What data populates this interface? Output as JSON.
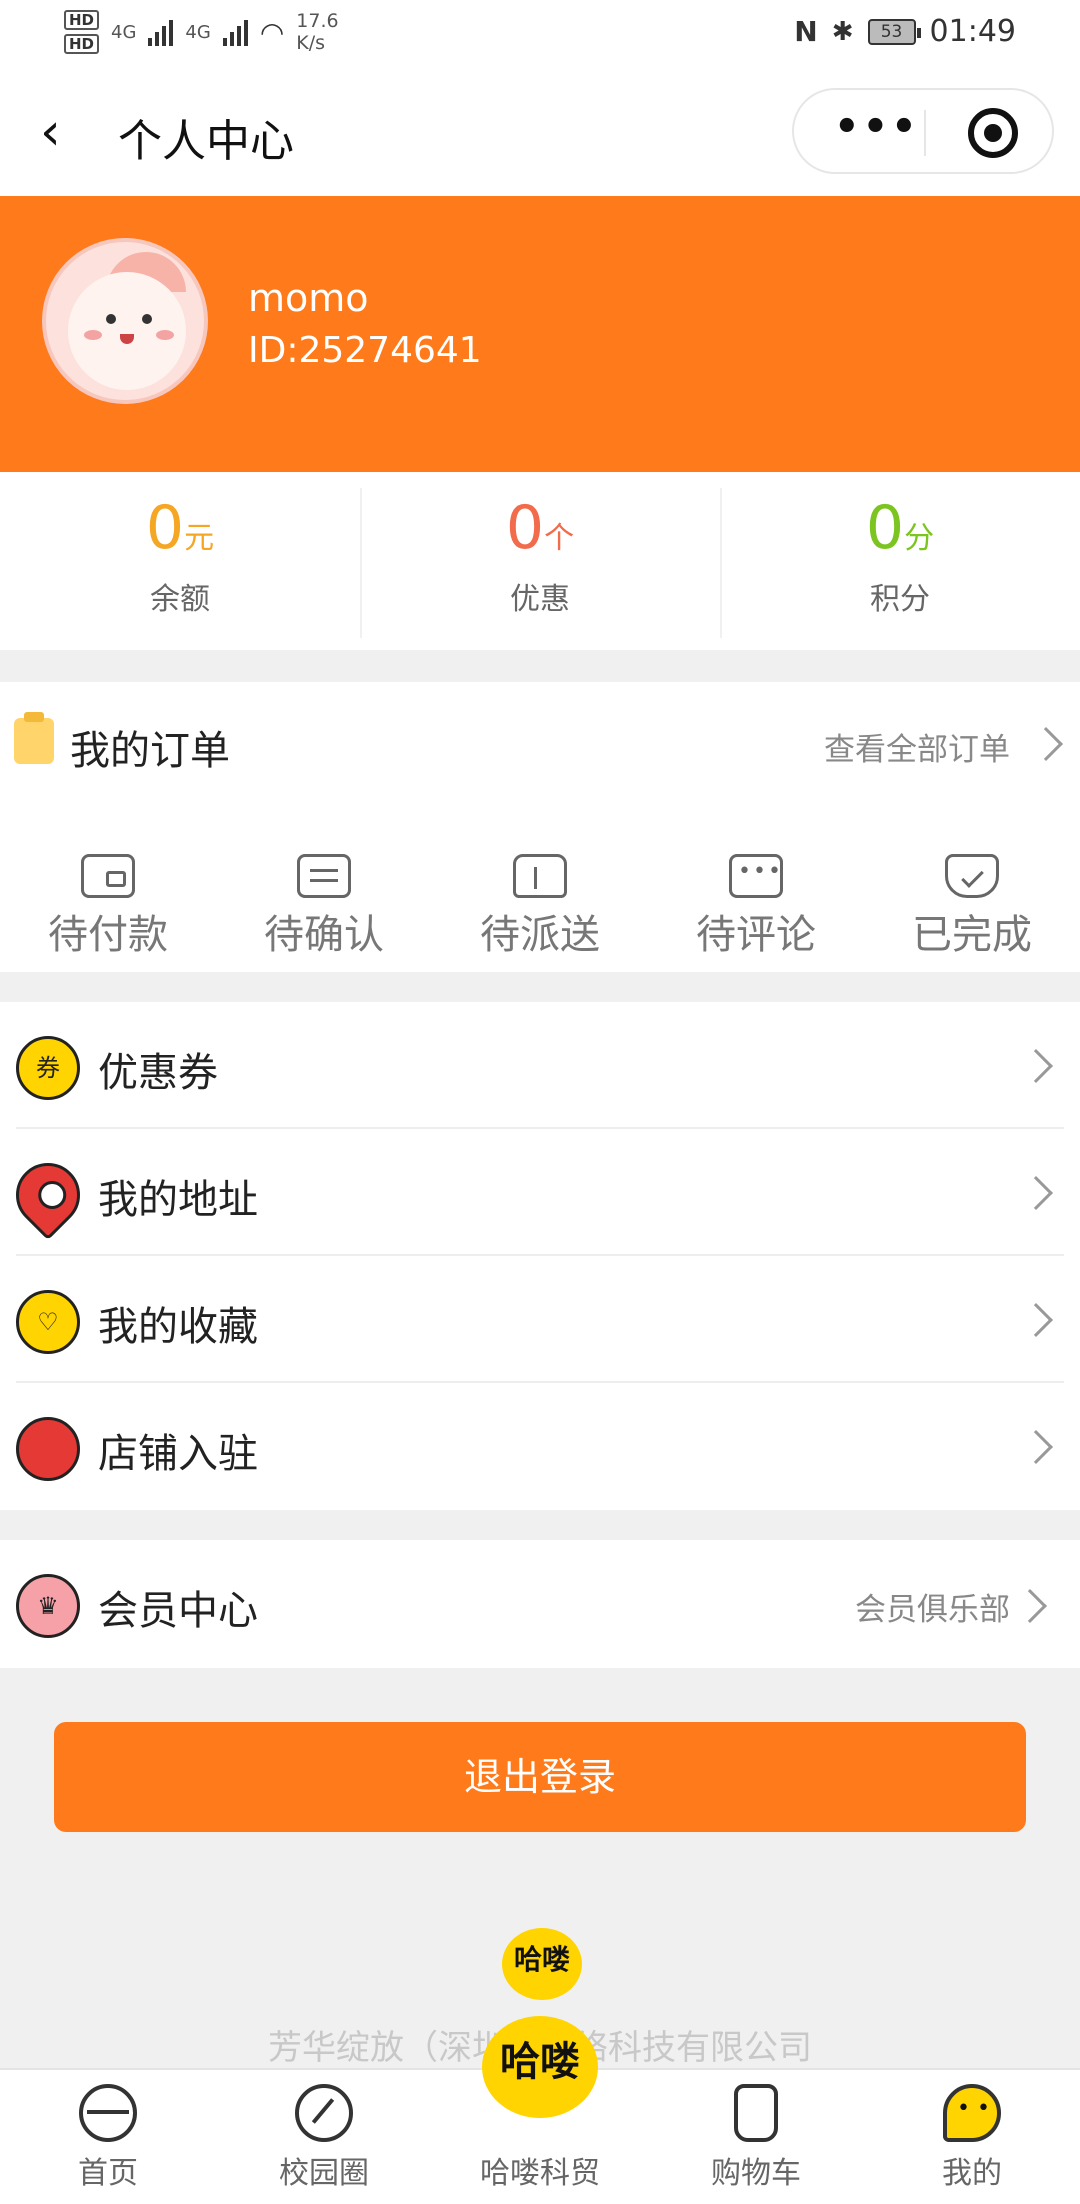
{
  "status_bar": {
    "hd1": "HD",
    "hd2": "HD",
    "net1": "4G",
    "net2": "4G",
    "speed": "17.6",
    "speed_unit": "K/s",
    "nfc": "N",
    "bluetooth": "✱",
    "battery": "53",
    "time": "01:49"
  },
  "nav": {
    "back": "‹",
    "title": "个人中心",
    "more": "•••"
  },
  "profile": {
    "username": "momo",
    "user_id": "ID:25274641"
  },
  "stats": [
    {
      "value": "0",
      "unit": "元",
      "label": "余额",
      "color": "#f5a623"
    },
    {
      "value": "0",
      "unit": "个",
      "label": "优惠",
      "color": "#f26b4a"
    },
    {
      "value": "0",
      "unit": "分",
      "label": "积分",
      "color": "#7cc520"
    }
  ],
  "orders": {
    "title": "我的订单",
    "view_all": "查看全部订单",
    "items": [
      {
        "label": "待付款",
        "icon": "wallet-icon"
      },
      {
        "label": "待确认",
        "icon": "confirm-icon"
      },
      {
        "label": "待派送",
        "icon": "delivery-icon"
      },
      {
        "label": "待评论",
        "icon": "comment-icon"
      },
      {
        "label": "已完成",
        "icon": "done-icon"
      }
    ]
  },
  "menu": [
    {
      "label": "优惠券",
      "icon": "coupon-icon",
      "icon_text": "券"
    },
    {
      "label": "我的地址",
      "icon": "location-icon",
      "icon_text": ""
    },
    {
      "label": "我的收藏",
      "icon": "heart-icon",
      "icon_text": "♡"
    },
    {
      "label": "店铺入驻",
      "icon": "shop-icon",
      "icon_text": ""
    }
  ],
  "vip": {
    "label": "会员中心",
    "right": "会员俱乐部",
    "icon": "crown-icon",
    "icon_text": "♛"
  },
  "logout_label": "退出登录",
  "brand": {
    "logo_text": "哈喽",
    "company": "芳华绽放（深圳）网络科技有限公司"
  },
  "tabbar": [
    {
      "label": "首页",
      "icon": "home-icon"
    },
    {
      "label": "校园圈",
      "icon": "campus-icon"
    },
    {
      "label": "哈喽科贸",
      "icon": "halo-logo-icon"
    },
    {
      "label": "购物车",
      "icon": "cart-icon"
    },
    {
      "label": "我的",
      "icon": "mine-icon"
    }
  ],
  "colors": {
    "brand_orange": "#fe7a1b",
    "logo_yellow": "#ffd400"
  }
}
